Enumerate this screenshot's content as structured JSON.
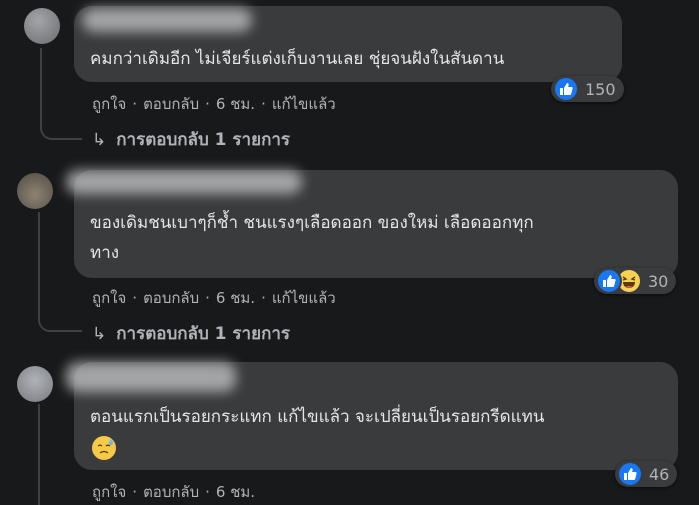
{
  "comments": [
    {
      "text_lines": [
        "คมกว่าเดิมอีก ไม่เจียร์แต่งเก็บงานเลย ชุ่ยจนฝังในสันดาน"
      ],
      "like_label": "ถูกใจ",
      "reply_label": "ตอบกลับ",
      "time": "6 ชม.",
      "edited_label": "แก้ไขแล้ว",
      "reaction_count": "150",
      "reactions": [
        "like-icon"
      ],
      "replies_label": "การตอบกลับ 1 รายการ"
    },
    {
      "text_lines": [
        "ของเดิมชนเบาๆก็ช้ำ ชนแรงๆเลือดออก ของใหม่ เลือดออกทุก",
        "ทาง"
      ],
      "like_label": "ถูกใจ",
      "reply_label": "ตอบกลับ",
      "time": "6 ชม.",
      "edited_label": "แก้ไขแล้ว",
      "reaction_count": "30",
      "reactions": [
        "like-icon",
        "haha-icon"
      ],
      "replies_label": "การตอบกลับ 1 รายการ"
    },
    {
      "text_lines": [
        "ตอนแรกเป็นรอยกระแทก แก้ไขแล้ว จะเปลี่ยนเป็นรอยกรีดแทน"
      ],
      "emoji": "downcast-sweat-emoji",
      "like_label": "ถูกใจ",
      "reply_label": "ตอบกลับ",
      "time": "6 ชม.",
      "reaction_count": "46",
      "reactions": [
        "like-icon"
      ]
    }
  ],
  "colors": {
    "background": "#18191a",
    "bubble": "#3a3b3c",
    "text": "#e4e6eb",
    "secondary": "#b0b3b8",
    "like_blue": "#1877f2"
  }
}
